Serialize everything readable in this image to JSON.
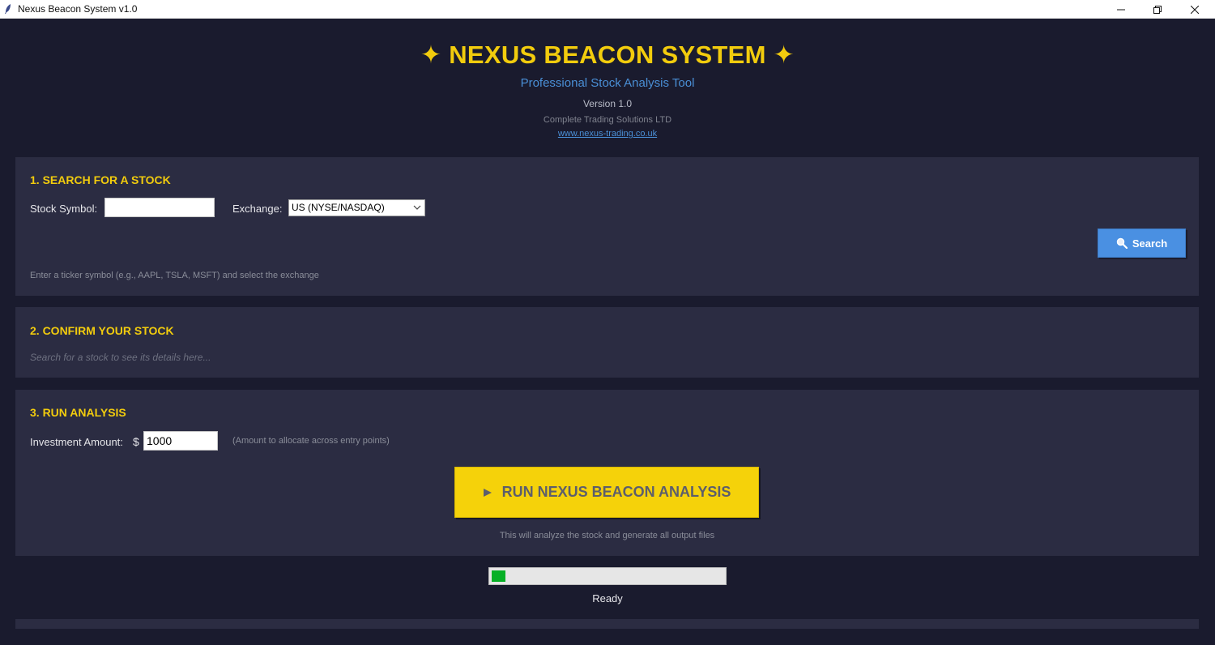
{
  "window": {
    "title": "Nexus Beacon System v1.0"
  },
  "header": {
    "title": "✦ NEXUS BEACON SYSTEM ✦",
    "subtitle": "Professional Stock Analysis Tool",
    "version": "Version 1.0",
    "company": "Complete Trading Solutions LTD",
    "website": "www.nexus-trading.co.uk"
  },
  "search_section": {
    "title": "1. SEARCH FOR A STOCK",
    "symbol_label": "Stock Symbol:",
    "symbol_value": "",
    "exchange_label": "Exchange:",
    "exchange_value": "US (NYSE/NASDAQ)",
    "search_button": "Search",
    "hint": "Enter a ticker symbol (e.g., AAPL, TSLA, MSFT) and select the exchange"
  },
  "confirm_section": {
    "title": "2. CONFIRM YOUR STOCK",
    "placeholder": "Search for a stock to see its details here..."
  },
  "analysis_section": {
    "title": "3. RUN ANALYSIS",
    "investment_label": "Investment Amount:",
    "currency_symbol": "$",
    "investment_value": "1000",
    "investment_hint": "(Amount to allocate across entry points)",
    "run_button": "RUN NEXUS BEACON ANALYSIS",
    "run_hint": "This will analyze the stock and generate all output files"
  },
  "progress": {
    "percent": 6,
    "status": "Ready"
  },
  "colors": {
    "background": "#1a1b2e",
    "panel": "#2b2c42",
    "accent_yellow": "#f2cc0d",
    "accent_blue": "#4a90e2",
    "progress_green": "#06b025"
  }
}
